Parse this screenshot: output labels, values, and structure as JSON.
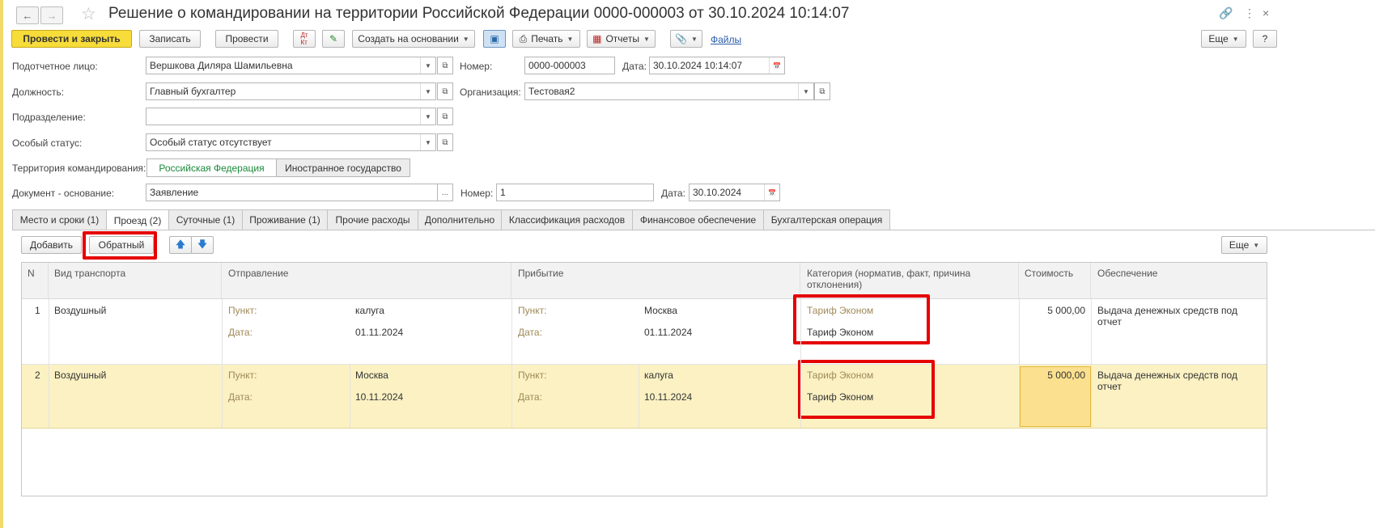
{
  "window": {
    "title": "Решение о командировании на территории Российской Федерации 0000-000003 от 30.10.2024 10:14:07"
  },
  "toolbar": {
    "post_close": "Провести и закрыть",
    "save": "Записать",
    "post": "Провести",
    "create_based": "Создать на основании",
    "print": "Печать",
    "reports": "Отчеты",
    "files": "Файлы",
    "more": "Еще"
  },
  "form": {
    "person_label": "Подотчетное лицо:",
    "person_value": "Вершкова Диляра Шамильевна",
    "position_label": "Должность:",
    "position_value": "Главный бухгалтер",
    "department_label": "Подразделение:",
    "department_value": "",
    "status_label": "Особый статус:",
    "status_value": "Особый статус отсутствует",
    "territory_label": "Территория командирования:",
    "territory_options": [
      "Российская Федерация",
      "Иностранное государство"
    ],
    "doc_label": "Документ - основание:",
    "doc_value": "Заявление",
    "number_label": "Номер:",
    "number_value": "0000-000003",
    "date_label": "Дата:",
    "date_value": "30.10.2024 10:14:07",
    "org_label": "Организация:",
    "org_value": "Тестовая2",
    "doc_number_label": "Номер:",
    "doc_number_value": "1",
    "doc_date_label": "Дата:",
    "doc_date_value": "30.10.2024"
  },
  "tabs": [
    {
      "label": "Место и сроки (1)"
    },
    {
      "label": "Проезд (2)"
    },
    {
      "label": "Суточные (1)"
    },
    {
      "label": "Проживание (1)"
    },
    {
      "label": "Прочие расходы"
    },
    {
      "label": "Дополнительно"
    },
    {
      "label": "Классификация расходов"
    },
    {
      "label": "Финансовое обеспечение"
    },
    {
      "label": "Бухгалтерская операция"
    }
  ],
  "tab_toolbar": {
    "add": "Добавить",
    "reverse": "Обратный",
    "more": "Еще"
  },
  "table": {
    "headers": {
      "n": "N",
      "transport": "Вид транспорта",
      "departure": "Отправление",
      "arrival": "Прибытие",
      "category": "Категория (норматив, факт, причина отклонения)",
      "cost": "Стоимость",
      "provision": "Обеспечение"
    },
    "point_label": "Пункт:",
    "date_label": "Дата:",
    "rows": [
      {
        "n": "1",
        "transport": "Воздушный",
        "dep_point": "калуга",
        "dep_date": "01.11.2024",
        "arr_point": "Москва",
        "arr_date": "01.11.2024",
        "cat_norm": "Тариф Эконом",
        "cat_fact": "Тариф Эконом",
        "cost": "5 000,00",
        "provision": "Выдача денежных средств под отчет"
      },
      {
        "n": "2",
        "transport": "Воздушный",
        "dep_point": "Москва",
        "dep_date": "10.11.2024",
        "arr_point": "калуга",
        "arr_date": "10.11.2024",
        "cat_norm": "Тариф Эконом",
        "cat_fact": "Тариф Эконом",
        "cost": "5 000,00",
        "provision": "Выдача денежных средств под отчет"
      }
    ]
  },
  "colors": {
    "primary_button": "#f7dc3a",
    "selected_row": "#fbf1c3",
    "highlight_box": "#e60000",
    "active_toggle_text": "#1a8a3a"
  }
}
